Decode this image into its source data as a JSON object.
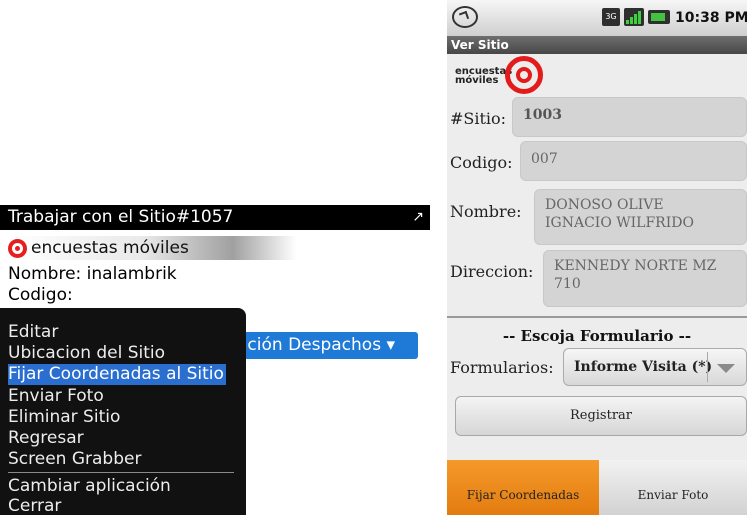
{
  "blackberry": {
    "title": "Trabajar con el Sitio#1057",
    "brand": "encuestas móviles",
    "nombre_line": "Nombre: inalambrik",
    "codigo_line": "Codigo:",
    "dropdown_text": "ación Despachos ▾",
    "menu": {
      "items": [
        "Editar",
        "Ubicacion del Sitio",
        "Fijar Coordenadas al Sitio",
        "Enviar Foto",
        "Eliminar Sitio",
        "Regresar",
        "Screen Grabber",
        "Cambiar aplicación",
        "Cerrar"
      ],
      "selected": "Fijar Coordenadas al Sitio"
    },
    "icons": {
      "resize": "expand-icon",
      "brand": "target-logo-icon"
    }
  },
  "android": {
    "status": {
      "time": "10:38 PM",
      "network": "3G",
      "icons": [
        "back-icon",
        "3g-icon",
        "signal-icon",
        "battery-icon"
      ]
    },
    "title": "Ver Sitio",
    "brand": {
      "line1": "encuestas",
      "line2": "móviles"
    },
    "fields": {
      "sitio": {
        "label": "#Sitio:",
        "value": "1003"
      },
      "codigo": {
        "label": "Codigo:",
        "value": "007"
      },
      "nombre": {
        "label": "Nombre:",
        "value_line1": "DONOSO OLIVE",
        "value_line2": "IGNACIO WILFRIDO"
      },
      "direccion": {
        "label": "Direccion:",
        "value_line1": "KENNEDY NORTE MZ",
        "value_line2": "710"
      }
    },
    "section_title": "-- Escoja Formulario --",
    "formularios": {
      "label": "Formularios:",
      "selected": "Informe Visita (*)"
    },
    "registrar_button": "Registrar",
    "tabs": [
      "Fijar Coordenadas",
      "Enviar Foto"
    ],
    "colors": {
      "active_tab": "#f08c1c",
      "brand_red": "#e31b1b",
      "menu_highlight": "#2a6fcf"
    }
  }
}
